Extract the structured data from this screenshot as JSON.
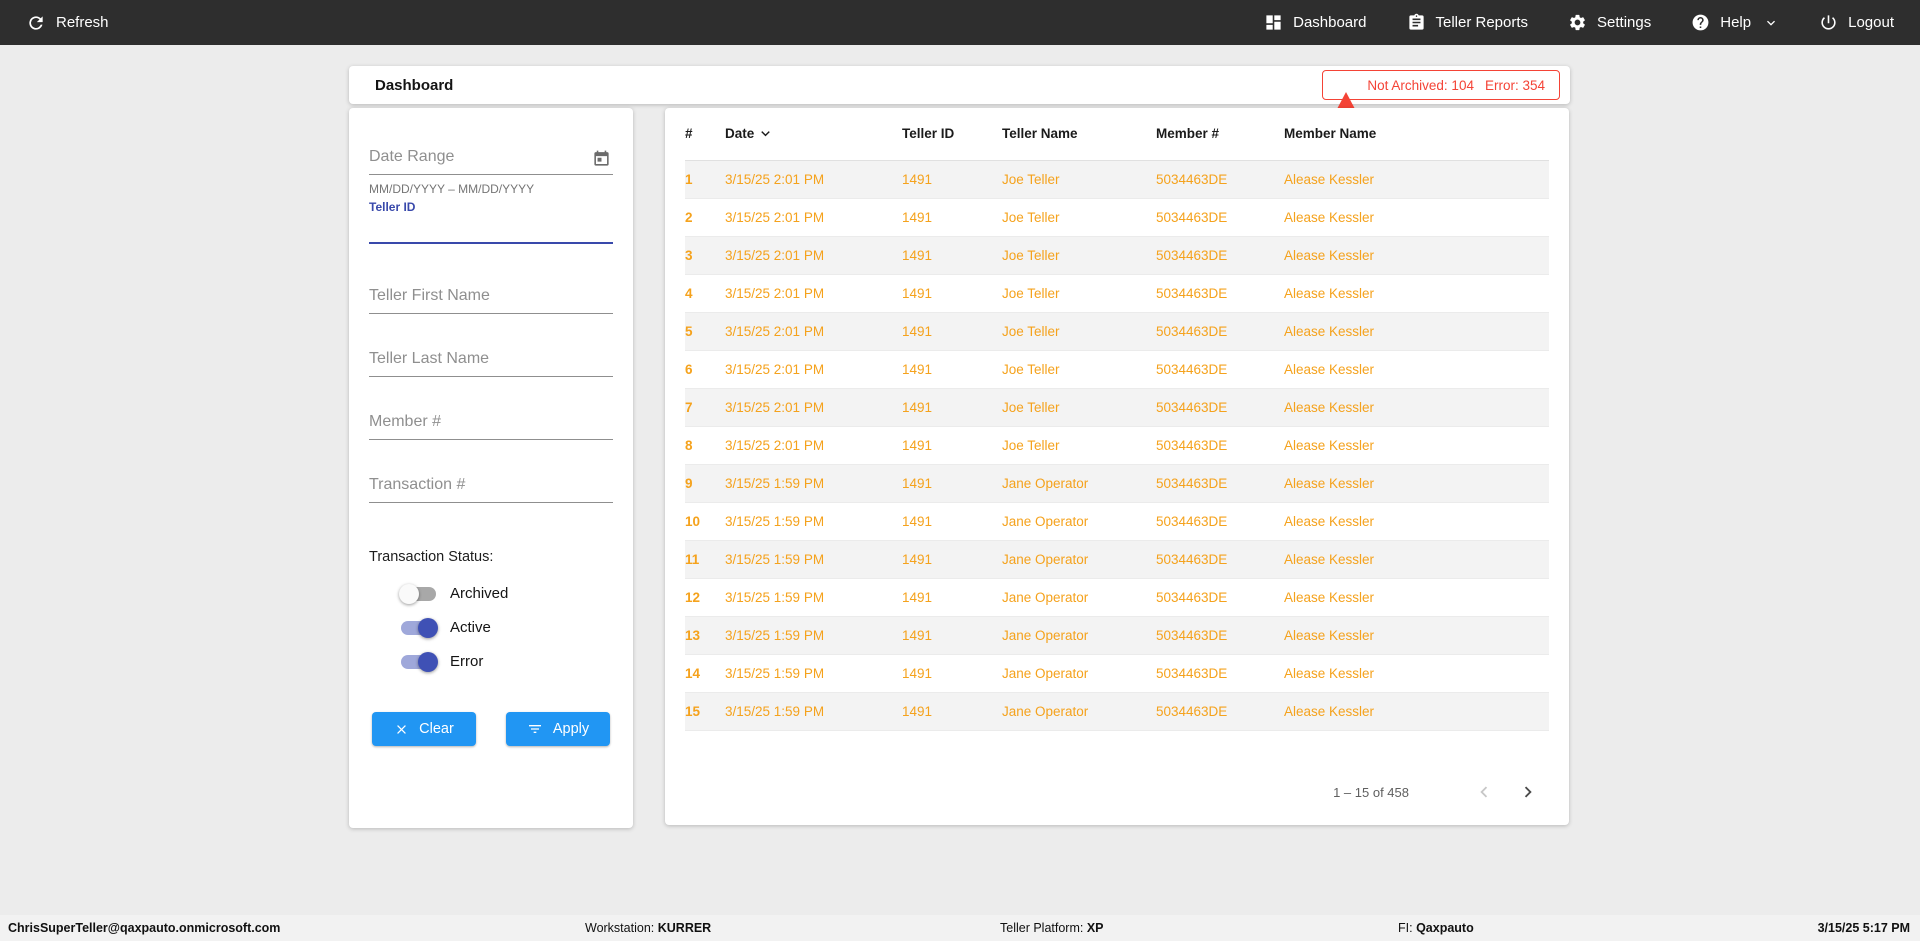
{
  "colors": {
    "accent_orange": "#F5A21C",
    "button_blue": "#2196F3",
    "toggle_indigo": "#3F51B5",
    "toggle_track_on": "#9FA8DA",
    "alert_red": "#F44336",
    "focus_indigo": "#3949AB"
  },
  "topbar": {
    "refresh_label": "Refresh",
    "nav": [
      {
        "label": "Dashboard"
      },
      {
        "label": "Teller Reports"
      },
      {
        "label": "Settings"
      },
      {
        "label": "Help"
      },
      {
        "label": "Logout"
      }
    ]
  },
  "header": {
    "title": "Dashboard",
    "alert": {
      "not_archived": "Not Archived: 104",
      "error": "Error: 354"
    }
  },
  "filters": {
    "date_range": {
      "placeholder": "Date Range",
      "hint": "MM/DD/YYYY – MM/DD/YYYY"
    },
    "teller_id_label": "Teller ID",
    "fields": [
      {
        "placeholder": "Teller First Name"
      },
      {
        "placeholder": "Teller Last Name"
      },
      {
        "placeholder": "Member #"
      },
      {
        "placeholder": "Transaction #"
      }
    ],
    "status": {
      "label": "Transaction Status:",
      "toggles": [
        {
          "label": "Archived",
          "on": false
        },
        {
          "label": "Active",
          "on": true
        },
        {
          "label": "Error",
          "on": true
        }
      ]
    },
    "clear_label": "Clear",
    "apply_label": "Apply"
  },
  "table": {
    "columns": [
      "#",
      "Date",
      "Teller ID",
      "Teller Name",
      "Member #",
      "Member Name"
    ],
    "sort_column": "Date",
    "rows": [
      {
        "num": "1",
        "date": "3/15/25 2:01 PM",
        "teller_id": "1491",
        "teller_name": "Joe Teller",
        "member_number": "5034463DE",
        "member_name": "Alease Kessler"
      },
      {
        "num": "2",
        "date": "3/15/25 2:01 PM",
        "teller_id": "1491",
        "teller_name": "Joe Teller",
        "member_number": "5034463DE",
        "member_name": "Alease Kessler"
      },
      {
        "num": "3",
        "date": "3/15/25 2:01 PM",
        "teller_id": "1491",
        "teller_name": "Joe Teller",
        "member_number": "5034463DE",
        "member_name": "Alease Kessler"
      },
      {
        "num": "4",
        "date": "3/15/25 2:01 PM",
        "teller_id": "1491",
        "teller_name": "Joe Teller",
        "member_number": "5034463DE",
        "member_name": "Alease Kessler"
      },
      {
        "num": "5",
        "date": "3/15/25 2:01 PM",
        "teller_id": "1491",
        "teller_name": "Joe Teller",
        "member_number": "5034463DE",
        "member_name": "Alease Kessler"
      },
      {
        "num": "6",
        "date": "3/15/25 2:01 PM",
        "teller_id": "1491",
        "teller_name": "Joe Teller",
        "member_number": "5034463DE",
        "member_name": "Alease Kessler"
      },
      {
        "num": "7",
        "date": "3/15/25 2:01 PM",
        "teller_id": "1491",
        "teller_name": "Joe Teller",
        "member_number": "5034463DE",
        "member_name": "Alease Kessler"
      },
      {
        "num": "8",
        "date": "3/15/25 2:01 PM",
        "teller_id": "1491",
        "teller_name": "Joe Teller",
        "member_number": "5034463DE",
        "member_name": "Alease Kessler"
      },
      {
        "num": "9",
        "date": "3/15/25 1:59 PM",
        "teller_id": "1491",
        "teller_name": "Jane Operator",
        "member_number": "5034463DE",
        "member_name": "Alease Kessler"
      },
      {
        "num": "10",
        "date": "3/15/25 1:59 PM",
        "teller_id": "1491",
        "teller_name": "Jane Operator",
        "member_number": "5034463DE",
        "member_name": "Alease Kessler"
      },
      {
        "num": "11",
        "date": "3/15/25 1:59 PM",
        "teller_id": "1491",
        "teller_name": "Jane Operator",
        "member_number": "5034463DE",
        "member_name": "Alease Kessler"
      },
      {
        "num": "12",
        "date": "3/15/25 1:59 PM",
        "teller_id": "1491",
        "teller_name": "Jane Operator",
        "member_number": "5034463DE",
        "member_name": "Alease Kessler"
      },
      {
        "num": "13",
        "date": "3/15/25 1:59 PM",
        "teller_id": "1491",
        "teller_name": "Jane Operator",
        "member_number": "5034463DE",
        "member_name": "Alease Kessler"
      },
      {
        "num": "14",
        "date": "3/15/25 1:59 PM",
        "teller_id": "1491",
        "teller_name": "Jane Operator",
        "member_number": "5034463DE",
        "member_name": "Alease Kessler"
      },
      {
        "num": "15",
        "date": "3/15/25 1:59 PM",
        "teller_id": "1491",
        "teller_name": "Jane Operator",
        "member_number": "5034463DE",
        "member_name": "Alease Kessler"
      }
    ],
    "pagination": {
      "range": "1 – 15 of 458"
    }
  },
  "footer": {
    "user": "ChrisSuperTeller@qaxpauto.onmicrosoft.com",
    "workstation_label": "Workstation:",
    "workstation_value": "KURRER",
    "platform_label": "Teller Platform:",
    "platform_value": "XP",
    "fi_label": "FI:",
    "fi_value": "Qaxpauto",
    "datetime": "3/15/25 5:17 PM"
  }
}
